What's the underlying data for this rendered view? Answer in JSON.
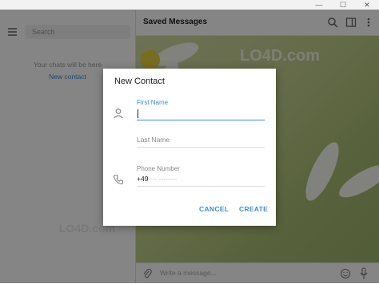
{
  "window": {
    "minimize": "—",
    "maximize": "☐",
    "close": "✕"
  },
  "sidebar": {
    "search_placeholder": "Search",
    "empty_text": "Your chats will be here",
    "new_contact_link": "New contact",
    "watermark": "LO4D.com"
  },
  "header": {
    "title": "Saved Messages"
  },
  "chat": {
    "watermark": "LO4D.com"
  },
  "compose": {
    "placeholder": "Write a message..."
  },
  "dialog": {
    "title": "New Contact",
    "first_name_label": "First Name",
    "first_name_value": "",
    "last_name_placeholder": "Last Name",
    "phone_label": "Phone Number",
    "phone_code": "+49",
    "phone_mask": " --- --------",
    "cancel": "CANCEL",
    "create": "CREATE"
  },
  "colors": {
    "accent": "#3a8fd6",
    "overlay": "rgba(0,0,0,0.48)"
  }
}
